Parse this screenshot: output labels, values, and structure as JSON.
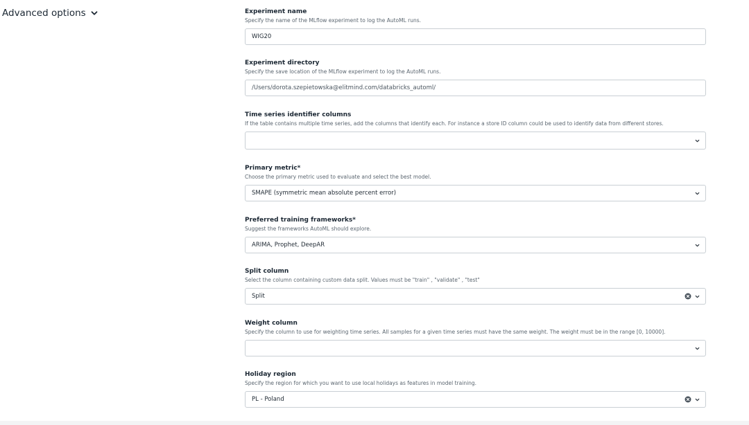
{
  "advanced": {
    "label": "Advanced options"
  },
  "fields": {
    "experiment_name": {
      "label": "Experiment name",
      "description": "Specify the name of the MLflow experiment to log the AutoML runs.",
      "value": "WIG20"
    },
    "experiment_directory": {
      "label": "Experiment directory",
      "description": "Specify the save location of the MLflow experiment to log the AutoML runs.",
      "value": "/Users/dorota.szepietowska@elitmind.com/databricks_automl/"
    },
    "time_series_identifier": {
      "label": "Time series identifier columns",
      "description": "If the table contains multiple time series, add the columns that identify each. For instance a store ID column could be used to identify data from different stores.",
      "value": ""
    },
    "primary_metric": {
      "label": "Primary metric*",
      "description": "Choose the primary metric used to evaluate and select the best model.",
      "value": "SMAPE (symmetric mean absolute percent error)"
    },
    "training_frameworks": {
      "label": "Preferred training frameworks*",
      "description": "Suggest the frameworks AutoML should explore.",
      "value": "ARIMA, Prophet, DeepAR"
    },
    "split_column": {
      "label": "Split column",
      "description": "Select the column containing custom data split. Values must be \"train\" , \"validate\" , \"test\"",
      "value": "Split"
    },
    "weight_column": {
      "label": "Weight column",
      "description": "Specify the column to use for weighting time series. All samples for a given time series must have the same weight. The weight must be in the range [0, 10000].",
      "value": ""
    },
    "holiday_region": {
      "label": "Holiday region",
      "description": "Specify the region for which you want to use local holidays as features in model training.",
      "value": "PL - Poland"
    }
  },
  "icons": {
    "chevron": "chevron-down-icon",
    "clear": "clear-circle-icon"
  },
  "colors": {
    "border": "#c9cfd4",
    "text": "#1f2933",
    "muted": "#5b6670"
  }
}
